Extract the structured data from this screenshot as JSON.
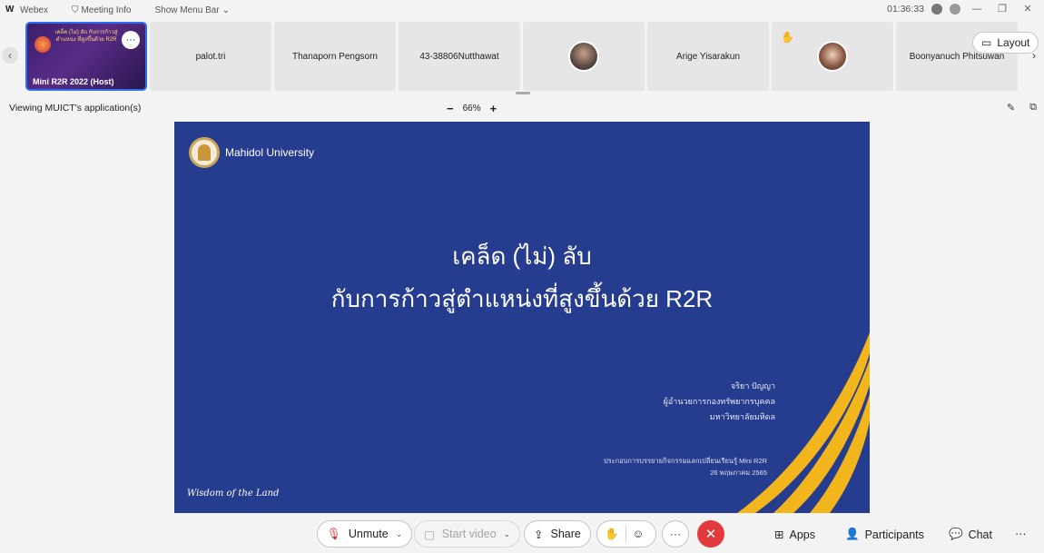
{
  "titlebar": {
    "brand": "Webex",
    "meeting_info": "Meeting Info",
    "show_menu_bar": "Show Menu Bar",
    "time": "01:36:33"
  },
  "participants": {
    "host": {
      "name": "Mini R2R 2022 (Host)",
      "art_text": "เคล็ด (ไม่) ลับ กับการก้าวสู่ตำแหน่ง ที่สูงขึ้นด้วย R2R",
      "more": "···"
    },
    "tiles": [
      {
        "name": "palot.tri"
      },
      {
        "name": "Thanaporn Pengsorn"
      },
      {
        "name": "43-38806Nutthawat"
      },
      {
        "name": ""
      },
      {
        "name": "Arige Yisarakun"
      },
      {
        "name": ""
      },
      {
        "name": "Boonyanuch Phitsuwan"
      }
    ],
    "layout_label": "Layout"
  },
  "viewbar": {
    "label": "Viewing MUICT's application(s)",
    "zoom_minus": "−",
    "zoom": "66%",
    "zoom_plus": "+"
  },
  "slide": {
    "university": "Mahidol University",
    "title_line1": "เคล็ด (ไม่) ลับ",
    "title_line2": "กับการก้าวสู่ตำแหน่งที่สูงขึ้นด้วย R2R",
    "author_name": "จริยา ปัญญา",
    "author_role": "ผู้อำนวยการกองทรัพยากรบุคคล",
    "author_org": "มหาวิทยาลัยมหิดล",
    "event_line1": "ประกอบการบรรยายกิจกรรมแลกเปลี่ยนเรียนรู้ Mini R2R",
    "event_line2": "26 พฤษภาคม 2565",
    "motto": "Wisdom of the Land",
    "colors": {
      "background": "#263c8e",
      "stripe": "#f2b51c"
    }
  },
  "controls": {
    "unmute": "Unmute",
    "start_video": "Start video",
    "share": "Share",
    "more": "···",
    "apps": "Apps",
    "participants": "Participants",
    "chat": "Chat",
    "overflow": "···",
    "end_color": "#e23a3a"
  }
}
